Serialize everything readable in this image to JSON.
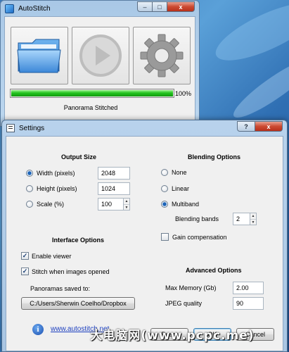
{
  "autostitch": {
    "title": "AutoStitch",
    "window_buttons": {
      "minimize": "–",
      "maximize": "□",
      "close": "x"
    },
    "progress_value": 1.0,
    "progress_label": "100%",
    "status": "Panorama Stitched"
  },
  "settings": {
    "title": "Settings",
    "title_buttons": {
      "help": "?",
      "close": "x"
    },
    "output_size": {
      "header": "Output Size",
      "width_label": "Width (pixels)",
      "width_value": "2048",
      "height_label": "Height (pixels)",
      "height_value": "1024",
      "scale_label": "Scale (%)",
      "scale_value": "100",
      "selected": "width"
    },
    "blending": {
      "header": "Blending Options",
      "none_label": "None",
      "linear_label": "Linear",
      "multiband_label": "Multiband",
      "bands_label": "Blending bands",
      "bands_value": "2",
      "gain_label": "Gain compensation",
      "gain_checked": false,
      "selected": "multiband"
    },
    "interface": {
      "header": "Interface Options",
      "enable_viewer_label": "Enable viewer",
      "enable_viewer_checked": true,
      "stitch_label": "Stitch when images opened",
      "stitch_checked": true,
      "saved_to_label": "Panoramas saved to:",
      "path_button": "C:/Users/Sherwin Coelho/Dropbox"
    },
    "advanced": {
      "header": "Advanced Options",
      "max_memory_label": "Max Memory (Gb)",
      "max_memory_value": "2.00",
      "jpeg_label": "JPEG quality",
      "jpeg_value": "90"
    },
    "info_icon_glyph": "i",
    "link_text": "www.autostitch.net",
    "buttons": {
      "reset": "Reset",
      "ok": "OK",
      "cancel": "Cancel"
    }
  },
  "watermark": "大电脑网(www.pcpc.me)"
}
